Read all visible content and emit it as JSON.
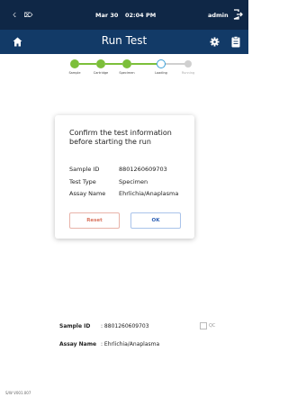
{
  "status_bar": {
    "date": "Mar 30",
    "time": "02:04 PM",
    "user": "admin",
    "icons": [
      "network-icon",
      "usb-icon"
    ]
  },
  "app_bar": {
    "title": "Run Test"
  },
  "stepper": {
    "steps": [
      {
        "label": "Sample",
        "state": "done"
      },
      {
        "label": "Cartridge",
        "state": "done"
      },
      {
        "label": "Specimen",
        "state": "done"
      },
      {
        "label": "Loading",
        "state": "current"
      },
      {
        "label": "Running",
        "state": "pending"
      }
    ],
    "colors": {
      "done": "#7cbf3a",
      "current": "#3aa0d8",
      "pending": "#d0d0d0"
    }
  },
  "dialog": {
    "heading": "Confirm the test information before starting the run",
    "rows": [
      {
        "label": "Sample ID",
        "value": "8801260609703"
      },
      {
        "label": "Test Type",
        "value": "Specimen"
      },
      {
        "label": "Assay Name",
        "value": "Ehrlichia/Anaplasma"
      }
    ],
    "reset_label": "Reset",
    "ok_label": "OK"
  },
  "info": {
    "sample_id_label": "Sample ID",
    "sample_id_value": ": 8801260609703",
    "assay_name_label": "Assay Name",
    "assay_name_value": ": Ehrlichia/Anaplasma",
    "qc_label": "QC"
  },
  "footer": {
    "version": "S/W V001.007"
  }
}
